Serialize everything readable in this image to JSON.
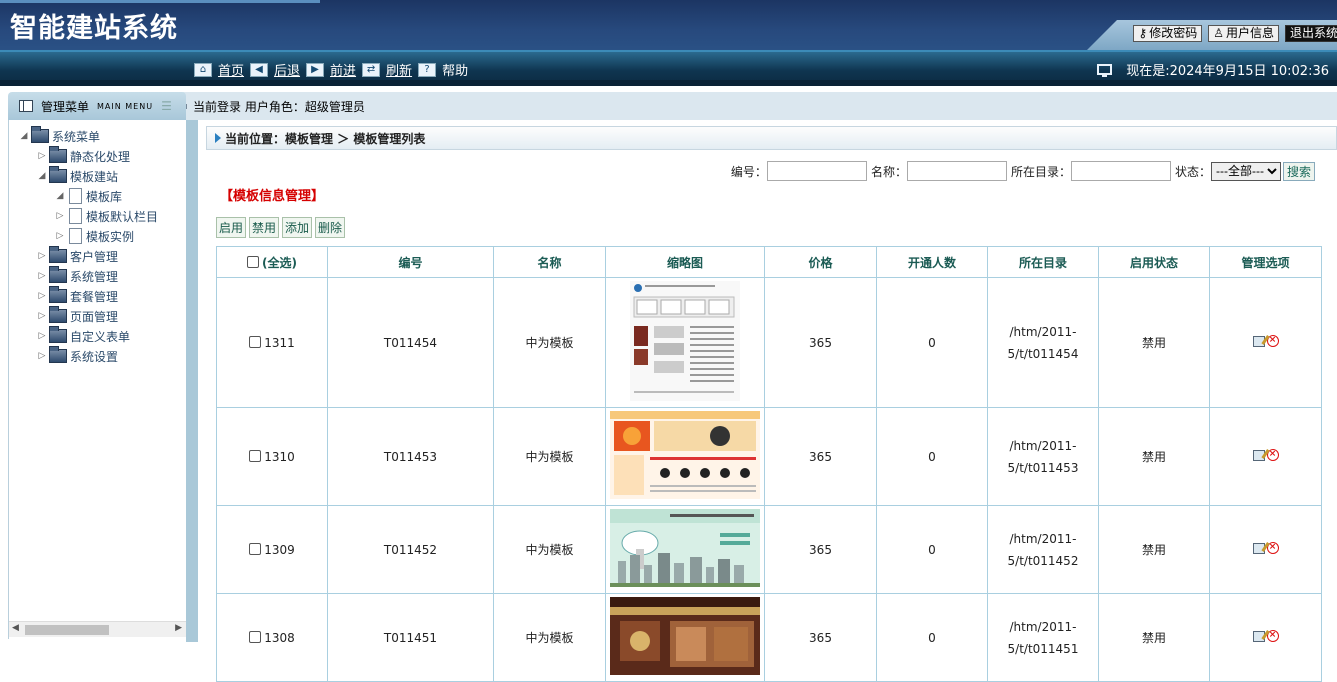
{
  "header": {
    "title": "智能建站系统",
    "buttons": {
      "change_password": "修改密码",
      "user_info": "用户信息",
      "logout": "退出系统"
    }
  },
  "nav": {
    "items": [
      {
        "label": "首页",
        "icon": "home-icon"
      },
      {
        "label": "后退",
        "icon": "back-arrow-icon"
      },
      {
        "label": "前进",
        "icon": "forward-arrow-icon"
      },
      {
        "label": "刷新",
        "icon": "refresh-icon"
      },
      {
        "label": "帮助",
        "icon": "help-icon"
      }
    ],
    "clock": "现在是:2024年9月15日 10:02:36"
  },
  "menu_header": {
    "title": "管理菜单",
    "subtitle": "MAIN MENU",
    "login_info": "当前登录 用户角色：超级管理员"
  },
  "tree": {
    "root": "系统菜单",
    "nodes": [
      {
        "label": "静态化处理"
      },
      {
        "label": "模板建站"
      },
      {
        "label": "模板库"
      },
      {
        "label": "模板默认栏目"
      },
      {
        "label": "模板实例"
      },
      {
        "label": "客户管理"
      },
      {
        "label": "系统管理"
      },
      {
        "label": "套餐管理"
      },
      {
        "label": "页面管理"
      },
      {
        "label": "自定义表单"
      },
      {
        "label": "系统设置"
      }
    ]
  },
  "breadcrumb": "当前位置：模板管理 ＞ 模板管理列表",
  "search": {
    "code_label": "编号：",
    "name_label": "名称：",
    "dir_label": "所在目录：",
    "status_label": "状态：",
    "status_value": "---全部---",
    "search_button": "搜索"
  },
  "section_title": "【模板信息管理】",
  "actions": {
    "enable": "启用",
    "disable": "禁用",
    "add": "添加",
    "delete": "删除"
  },
  "table": {
    "headers": {
      "select_all": "(全选)",
      "code": "编号",
      "name": "名称",
      "thumb": "缩略图",
      "price": "价格",
      "users": "开通人数",
      "dir": "所在目录",
      "status": "启用状态",
      "ops": "管理选项"
    },
    "rows": [
      {
        "id": "1311",
        "code": "T011454",
        "name": "中为模板",
        "price": "365",
        "users": "0",
        "dir_1": "/htm/2011-",
        "dir_2": "5/t/t011454",
        "status": "禁用"
      },
      {
        "id": "1310",
        "code": "T011453",
        "name": "中为模板",
        "price": "365",
        "users": "0",
        "dir_1": "/htm/2011-",
        "dir_2": "5/t/t011453",
        "status": "禁用"
      },
      {
        "id": "1309",
        "code": "T011452",
        "name": "中为模板",
        "price": "365",
        "users": "0",
        "dir_1": "/htm/2011-",
        "dir_2": "5/t/t011452",
        "status": "禁用"
      },
      {
        "id": "1308",
        "code": "T011451",
        "name": "中为模板",
        "price": "365",
        "users": "0",
        "dir_1": "/htm/2011-",
        "dir_2": "5/t/t011451",
        "status": "禁用"
      }
    ]
  }
}
